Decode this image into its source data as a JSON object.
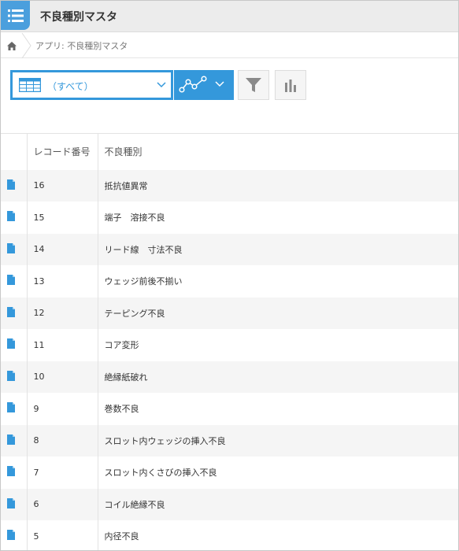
{
  "header": {
    "app_title": "不良種別マスタ",
    "app_icon": "list-icon"
  },
  "breadcrumb": {
    "home_icon": "home-icon",
    "path": "アプリ: 不良種別マスタ"
  },
  "toolbar": {
    "view_label": "（すべて）",
    "view_icon": "table-icon",
    "graph_icon": "line-graph-icon",
    "filter_icon": "filter-icon",
    "chart_icon": "bar-chart-icon"
  },
  "table": {
    "headers": {
      "record_number": "レコード番号",
      "defect_type": "不良種別"
    },
    "rows": [
      {
        "id": "16",
        "type": "抵抗値異常"
      },
      {
        "id": "15",
        "type": "端子　溶接不良"
      },
      {
        "id": "14",
        "type": "リード線　寸法不良"
      },
      {
        "id": "13",
        "type": "ウェッジ前後不揃い"
      },
      {
        "id": "12",
        "type": "テーピング不良"
      },
      {
        "id": "11",
        "type": "コア変形"
      },
      {
        "id": "10",
        "type": "絶縁紙破れ"
      },
      {
        "id": "9",
        "type": "巻数不良"
      },
      {
        "id": "8",
        "type": "スロット内ウェッジの挿入不良"
      },
      {
        "id": "7",
        "type": "スロット内くさびの挿入不良"
      },
      {
        "id": "6",
        "type": "コイル絶縁不良"
      },
      {
        "id": "5",
        "type": "内径不良"
      }
    ]
  },
  "colors": {
    "accent": "#3498db",
    "header_bg": "#ececec",
    "row_alt": "#f5f5f5"
  }
}
